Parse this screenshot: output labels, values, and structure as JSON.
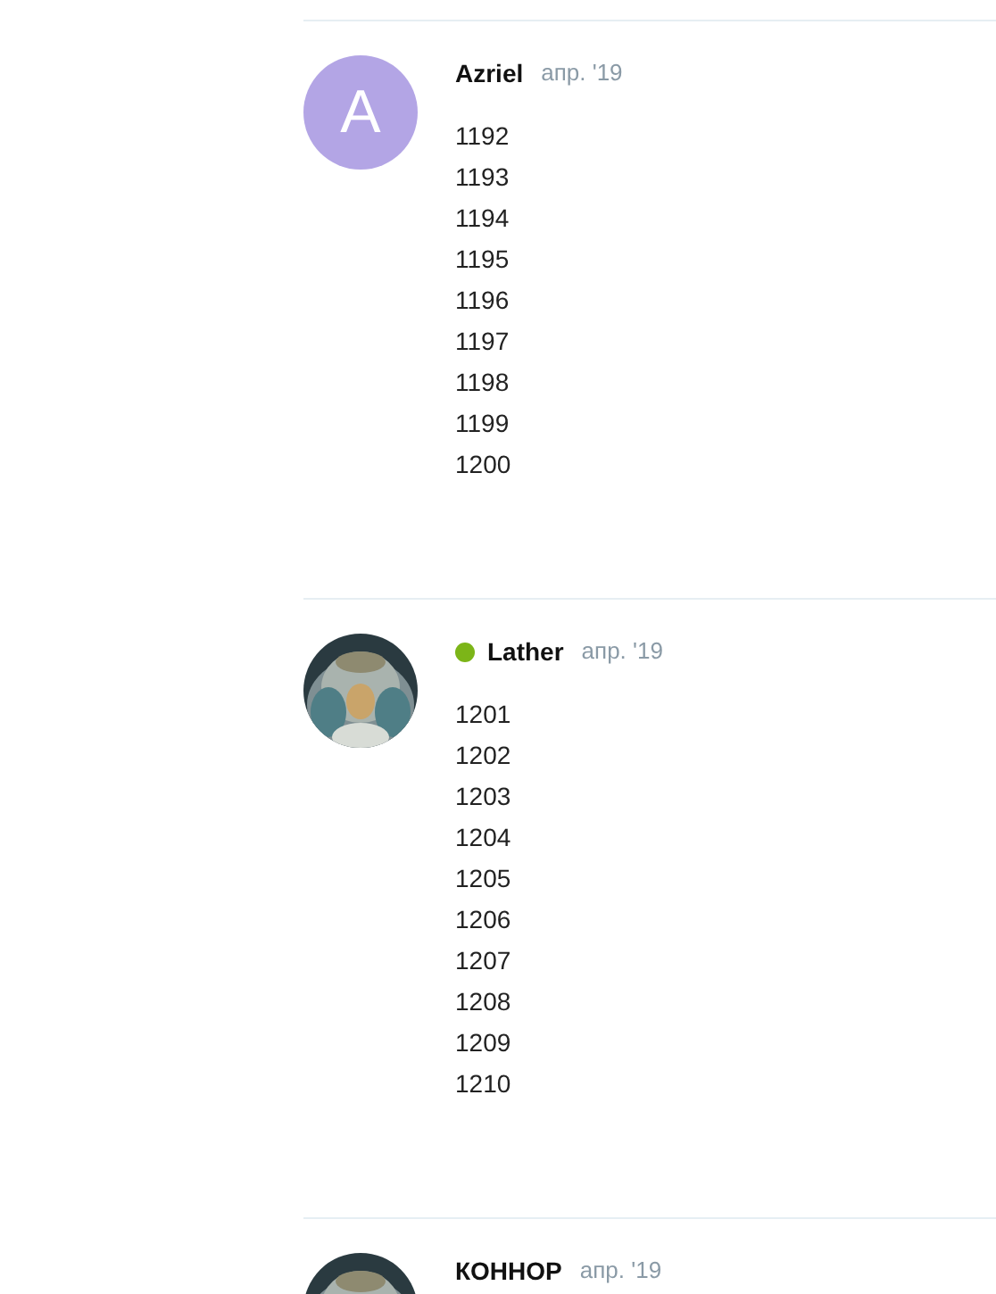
{
  "posts": [
    {
      "author": "Azriel",
      "online": false,
      "date": "апр. '19",
      "avatar": {
        "kind": "letter",
        "letter": "A",
        "color": "#b3a5e5"
      },
      "lines": [
        "1192",
        "1193",
        "1194",
        "1195",
        "1196",
        "1197",
        "1198",
        "1199",
        "1200"
      ]
    },
    {
      "author": "Lather",
      "online": true,
      "date": "апр. '19",
      "lines": [
        "1201",
        "1202",
        "1203",
        "1204",
        "1205",
        "1206",
        "1207",
        "1208",
        "1209",
        "1210"
      ]
    },
    {
      "author": "КОННОР",
      "online": false,
      "date": "апр. '19"
    }
  ]
}
